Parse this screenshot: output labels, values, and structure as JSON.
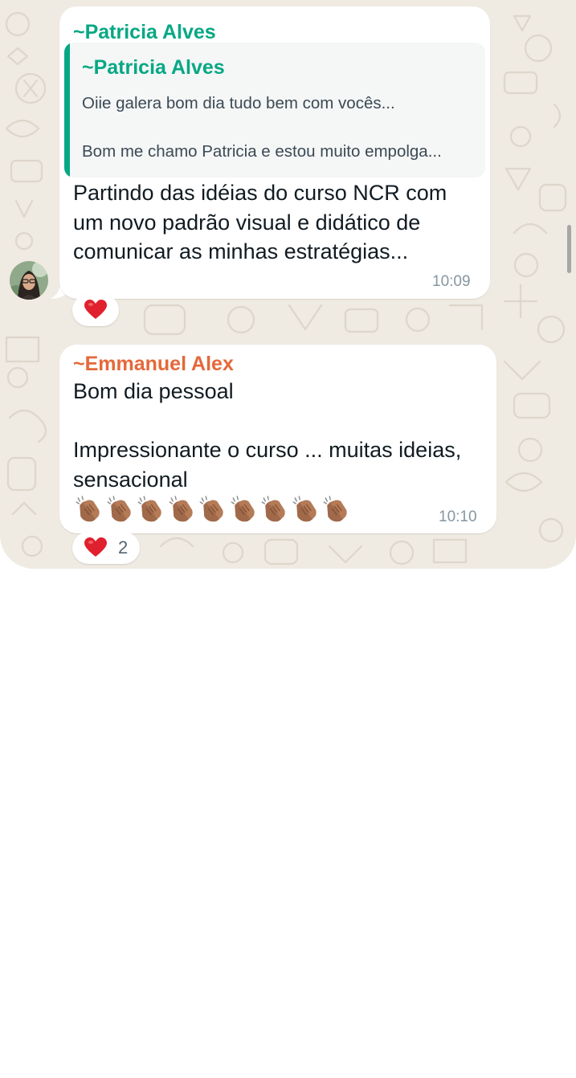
{
  "colors": {
    "chat_background": "#efeae2",
    "bubble": "#ffffff",
    "sender_1": "#06a884",
    "sender_2": "#e5683a",
    "timestamp": "#8696a0"
  },
  "messages": [
    {
      "sender": "~Patricia Alves",
      "quoted": {
        "sender": "~Patricia Alves",
        "line_1": "Oiie galera bom dia tudo bem com vocês...",
        "line_2": "Bom me chamo Patricia e estou muito empolga..."
      },
      "text": "Partindo das idéias do curso NCR com\num novo padrão visual e didático de\ncomunicar as minhas estratégias...",
      "time": "10:09",
      "reaction": {
        "emoji": "heart-icon",
        "count": ""
      }
    },
    {
      "sender": "~Emmanuel Alex",
      "text": "Bom dia pessoal\n\nImpressionante o curso ... muitas ideias,\nsensacional",
      "emoji_count": 9,
      "emoji": "clapping-hands-icon",
      "time": "10:10",
      "reaction": {
        "emoji": "heart-icon",
        "count": "2"
      }
    }
  ]
}
